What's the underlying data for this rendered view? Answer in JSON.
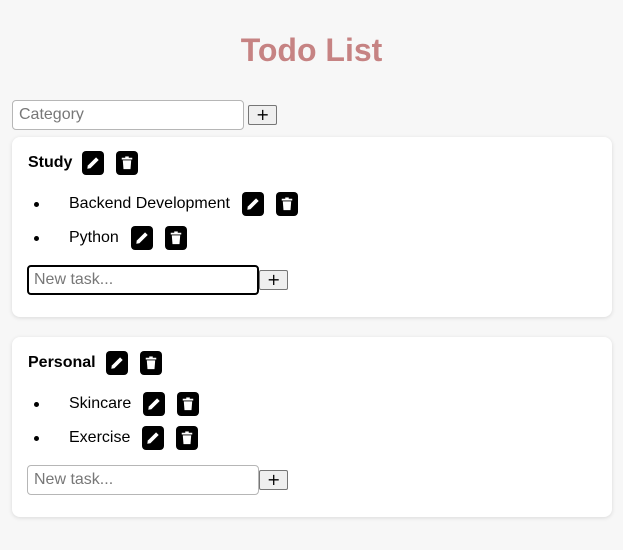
{
  "title": "Todo List",
  "new_category": {
    "placeholder": "Category",
    "add_label": "+"
  },
  "categories": [
    {
      "name": "Study",
      "tasks": [
        {
          "text": "Backend Development"
        },
        {
          "text": "Python"
        }
      ],
      "new_task_placeholder": "New task...",
      "add_task_label": "+"
    },
    {
      "name": "Personal",
      "tasks": [
        {
          "text": "Skincare"
        },
        {
          "text": "Exercise"
        }
      ],
      "new_task_placeholder": "New task...",
      "add_task_label": "+"
    }
  ],
  "icons": {
    "edit": "pencil-icon",
    "delete": "trash-icon"
  },
  "colors": {
    "title": "#c68383",
    "icon_button_bg": "#000000",
    "page_bg": "#f7f7f7"
  }
}
